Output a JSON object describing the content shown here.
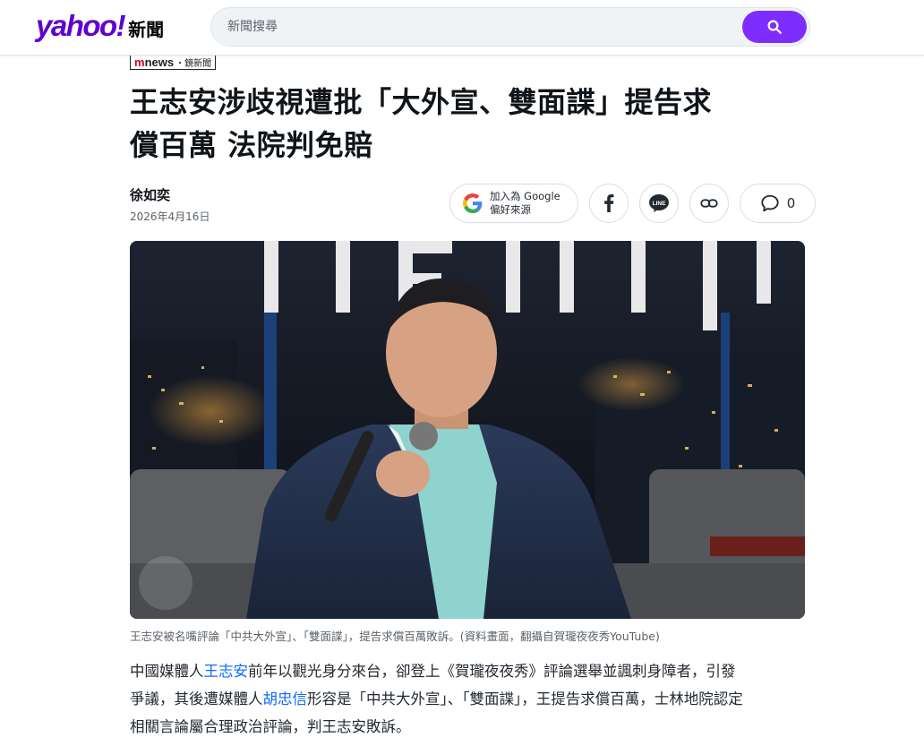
{
  "header": {
    "logo_brand": "yahoo!",
    "logo_section": "新聞",
    "search_placeholder": "新聞搜尋"
  },
  "article": {
    "provider": {
      "m": "m",
      "news": "news",
      "cn": "・鏡新聞"
    },
    "headline_line1": "王志安涉歧視遭批「大外宣、雙面諜」提告求",
    "headline_line2": "償百萬 法院判免賠",
    "author": "徐如奕",
    "date": "2026年4月16日",
    "google_line1": "加入為 Google",
    "google_line2": "偏好來源",
    "comment_count": "0",
    "caption": "王志安被名嘴評論「中共大外宣」、「雙面諜」，提告求償百萬敗訴。(資料畫面，翻攝自賀瓏夜夜秀YouTube)",
    "body": {
      "p1_a": "中國媒體人",
      "p1_link1": "王志安",
      "p1_b": "前年以觀光身分來台，卻登上《賀瓏夜夜秀》評論選舉並諷刺身障者，引發",
      "p2_a": "爭議，其後遭媒體人",
      "p2_link2": "胡忠信",
      "p2_b": "形容是「中共大外宣」、「雙面諜」，王提告求償百萬，士林地院認定",
      "p3": "相關言論屬合理政治評論，判王志安敗訴。"
    }
  },
  "colors": {
    "brand_purple": "#6001d2",
    "search_button": "#7d2eff",
    "link": "#0f69ff"
  }
}
